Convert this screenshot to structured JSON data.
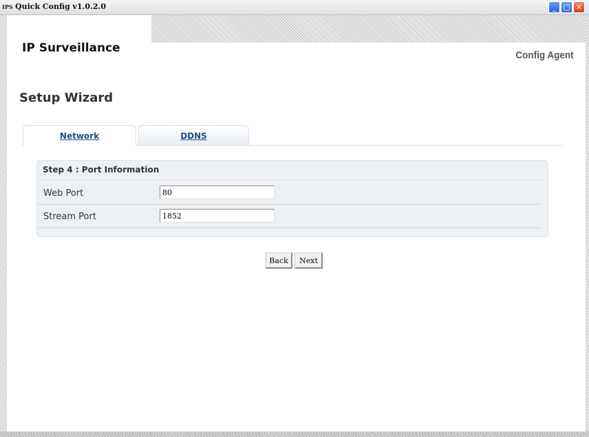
{
  "window": {
    "badge": "IPS",
    "title": "Quick Config v1.0.2.0",
    "controls": {
      "minimize": "_",
      "maximize": "□",
      "close": "✕"
    }
  },
  "brand": {
    "title": "IP Surveillance",
    "subtitle": "Config Agent"
  },
  "page": {
    "title": "Setup Wizard"
  },
  "tabs": [
    {
      "label": "Network",
      "active": true
    },
    {
      "label": "DDNS",
      "active": false
    }
  ],
  "panel": {
    "title": "Step 4 : Port Information",
    "rows": [
      {
        "label": "Web Port",
        "value": "80"
      },
      {
        "label": "Stream Port",
        "value": "1852"
      }
    ]
  },
  "buttons": {
    "back": "Back",
    "next": "Next"
  },
  "colors": {
    "tab_link": "#1e4f86",
    "panel_bg": "#eef1f4",
    "close_button": "#d63b1a"
  }
}
